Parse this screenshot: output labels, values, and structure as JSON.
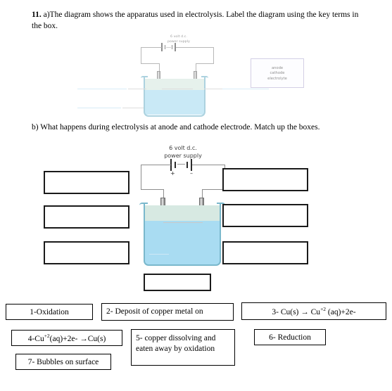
{
  "questions": {
    "q11_number": "11.",
    "q11_text": " a)The diagram shows the apparatus used in electrolysis. Label the diagram using the key terms in the box.",
    "qb_text": "b) What happens during electrolysis at anode and cathode electrode. Match up the boxes."
  },
  "diagram1": {
    "power_supply_label_line1": "6 volt d.c.",
    "power_supply_label_line2": "power supply",
    "key_terms": [
      "anode",
      "cathode",
      "electrolyte"
    ]
  },
  "diagram2": {
    "power_supply_label_line1": "6 volt d.c.",
    "power_supply_label_line2": "power supply",
    "positive_terminal": "+",
    "negative_terminal": "–"
  },
  "blank_boxes": {
    "count": 7,
    "value": ""
  },
  "options": [
    {
      "id": "1",
      "number": "1-",
      "text": "Oxidation",
      "full": "1-Oxidation"
    },
    {
      "id": "2",
      "number": "2-",
      "text": " Deposit of copper metal on",
      "full": "2- Deposit of copper metal on"
    },
    {
      "id": "3",
      "number": "3-",
      "text": " Cu(s) → Cu+2 (aq)+2e-",
      "full": "3- Cu(s) → Cu+2 (aq)+2e-"
    },
    {
      "id": "4",
      "number": "4-",
      "text": "Cu+2(aq)+2e- →Cu(s)",
      "full": "4-Cu+2(aq)+2e- →Cu(s)"
    },
    {
      "id": "5",
      "number": "5-",
      "text": " copper dissolving and eaten away by oxidation",
      "full": "5- copper dissolving and eaten away by oxidation"
    },
    {
      "id": "6",
      "number": "6-",
      "text": " Reduction",
      "full": "6- Reduction"
    },
    {
      "id": "7",
      "number": "7-",
      "text": " Bubbles on surface",
      "full": "7- Bubbles on surface"
    }
  ],
  "colors": {
    "liquid": "#a9dcf2",
    "beaker_outline": "#7ab8cc",
    "key_box_border": "#b9b3d6",
    "box_border": "#1a1a1a"
  }
}
